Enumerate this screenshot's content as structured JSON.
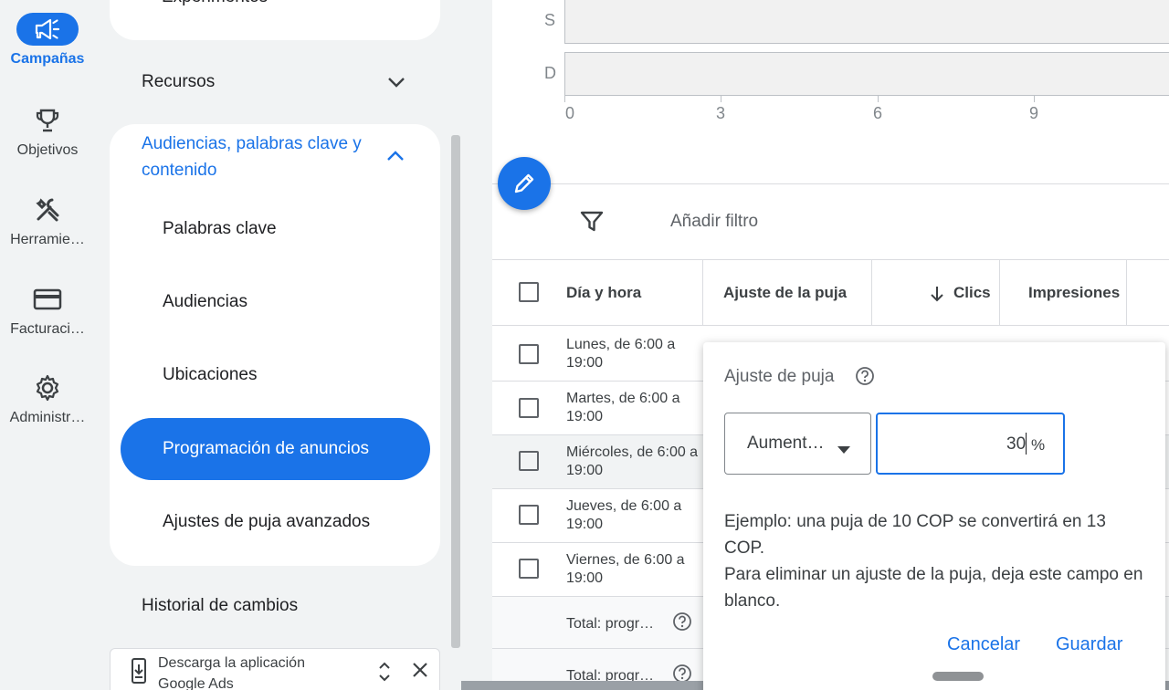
{
  "rail": {
    "items": [
      {
        "label": "Campañas",
        "icon": "megaphone-icon",
        "active": true
      },
      {
        "label": "Objetivos",
        "icon": "trophy-icon"
      },
      {
        "label": "Herramie…",
        "icon": "tools-icon"
      },
      {
        "label": "Facturaci…",
        "icon": "credit-card-icon"
      },
      {
        "label": "Administr…",
        "icon": "gear-icon"
      }
    ]
  },
  "nav": {
    "experiments_label": "Experimentos",
    "resources_label": "Recursos",
    "audiences_section_label": "Audiencias, palabras clave y contenido",
    "items": [
      {
        "label": "Palabras clave"
      },
      {
        "label": "Audiencias"
      },
      {
        "label": "Ubicaciones"
      },
      {
        "label": "Programación de anuncios",
        "active": true
      },
      {
        "label": "Ajustes de puja avanzados"
      }
    ],
    "history_label": "Historial de cambios",
    "download_banner": {
      "line1": "Descarga la aplicación",
      "line2": "Google Ads"
    }
  },
  "chart": {
    "rows": [
      "S",
      "D"
    ],
    "ticks": [
      "0",
      "3",
      "6",
      "9"
    ]
  },
  "filter": {
    "label": "Añadir filtro"
  },
  "table": {
    "headers": {
      "day_time": "Día y hora",
      "bid_adj": "Ajuste de la puja",
      "clicks": "Clics",
      "impressions": "Impresiones"
    },
    "rows": [
      {
        "day_time": "Lunes, de 6:00 a 19:00"
      },
      {
        "day_time": "Martes, de 6:00 a 19:00"
      },
      {
        "day_time": "Miércoles, de 6:00 a 19:00"
      },
      {
        "day_time": "Jueves, de 6:00 a 19:00"
      },
      {
        "day_time": "Viernes, de 6:00 a 19:00"
      }
    ],
    "totals": [
      {
        "label": "Total: progr…"
      },
      {
        "label": "Total: progr…"
      }
    ]
  },
  "popover": {
    "title": "Ajuste de puja",
    "select_value": "Aument…",
    "input_value": "30",
    "input_suffix": "%",
    "example_line1": "Ejemplo: una puja de 10 COP se convertirá en 13 COP.",
    "example_line2": "Para eliminar un ajuste de la puja, deja este campo en blanco.",
    "cancel_label": "Cancelar",
    "save_label": "Guardar"
  },
  "colors": {
    "accent": "#1a73e8",
    "rail_bg": "#f1f3f4"
  }
}
